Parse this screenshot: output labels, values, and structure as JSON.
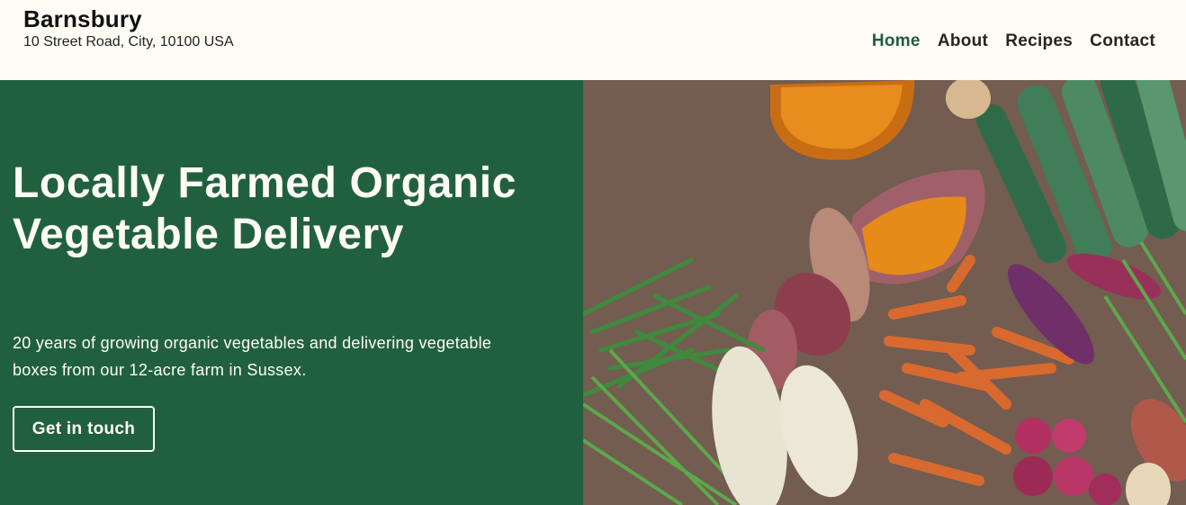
{
  "header": {
    "brand_name": "Barnsbury",
    "address": "10 Street Road, City, 10100 USA"
  },
  "nav": {
    "items": [
      {
        "label": "Home",
        "active": true
      },
      {
        "label": "About",
        "active": false
      },
      {
        "label": "Recipes",
        "active": false
      },
      {
        "label": "Contact",
        "active": false
      }
    ]
  },
  "hero": {
    "title": "Locally Farmed Organic Vegetable Delivery",
    "subtitle": "20 years of growing organic vegetables and delivering vegetable boxes from our 12-acre farm in Sussex.",
    "cta_label": "Get in touch",
    "image_alt": "Assorted fresh vegetables on burlap"
  },
  "colors": {
    "background": "#fffcf5",
    "hero_green": "#21603f",
    "nav_active": "#1f5e3e",
    "text_dark": "#2b2320"
  }
}
